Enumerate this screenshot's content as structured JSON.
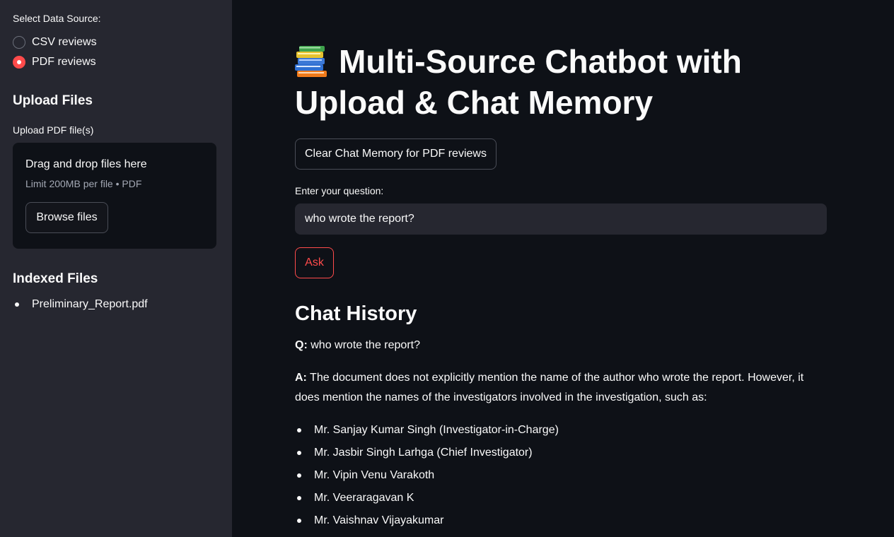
{
  "sidebar": {
    "data_source_label": "Select Data Source:",
    "options": [
      {
        "label": "CSV reviews",
        "selected": false
      },
      {
        "label": "PDF reviews",
        "selected": true
      }
    ],
    "upload_heading": "Upload Files",
    "upload_label": "Upload PDF file(s)",
    "dropzone": {
      "title": "Drag and drop files here",
      "limit": "Limit 200MB per file • PDF",
      "browse_label": "Browse files"
    },
    "indexed_heading": "Indexed Files",
    "indexed_files": [
      "Preliminary_Report.pdf"
    ]
  },
  "main": {
    "title_icon": "books-icon",
    "title": "Multi-Source Chatbot with Upload & Chat Memory",
    "clear_button": "Clear Chat Memory for PDF reviews",
    "question_label": "Enter your question:",
    "question_value": "who wrote the report?",
    "ask_button": "Ask",
    "history_heading": "Chat History",
    "q_prefix": "Q:",
    "q_text": "who wrote the report?",
    "a_prefix": "A:",
    "a_text": "The document does not explicitly mention the name of the author who wrote the report. However, it does mention the names of the investigators involved in the investigation, such as:",
    "investigators": [
      "Mr. Sanjay Kumar Singh (Investigator-in-Charge)",
      "Mr. Jasbir Singh Larhga (Chief Investigator)",
      "Mr. Vipin Venu Varakoth",
      "Mr. Veeraragavan K",
      "Mr. Vaishnav Vijayakumar"
    ]
  },
  "colors": {
    "accent": "#ff4b4b",
    "sidebar_bg": "#262730",
    "main_bg": "#0e1117"
  }
}
